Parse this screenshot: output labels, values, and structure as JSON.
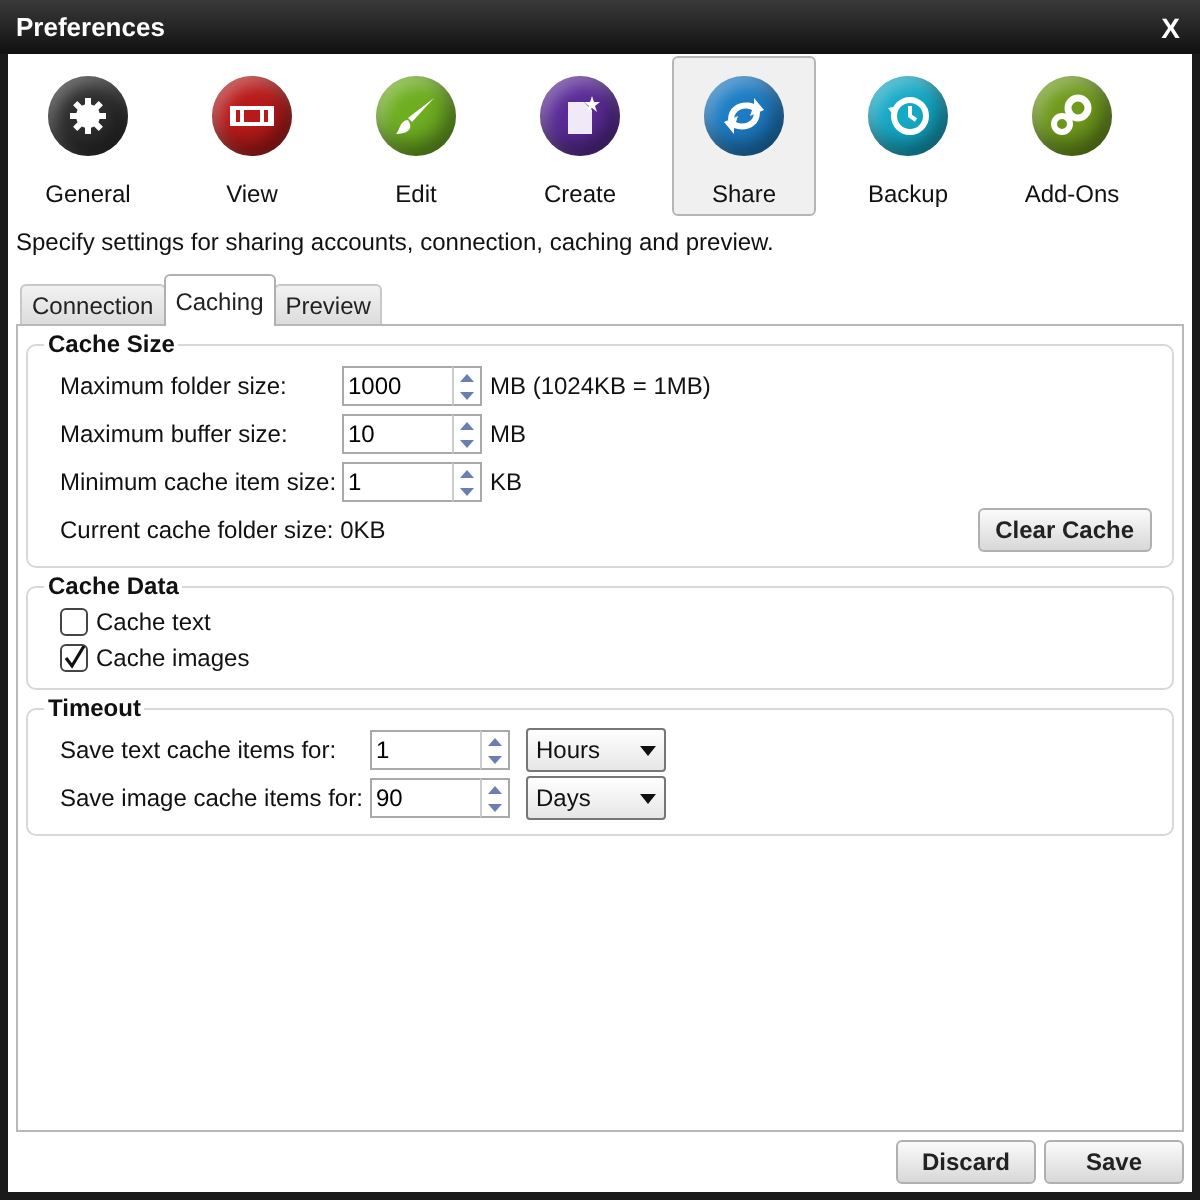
{
  "window": {
    "title": "Preferences",
    "close": "X"
  },
  "toolbar": [
    {
      "label": "General",
      "kind": "gear",
      "color": "#2e2e2e",
      "selected": false
    },
    {
      "label": "View",
      "kind": "film",
      "color": "#b81a1a",
      "selected": false
    },
    {
      "label": "Edit",
      "kind": "brush",
      "color": "#6fae22",
      "selected": false
    },
    {
      "label": "Create",
      "kind": "document",
      "color": "#5a2b96",
      "selected": false
    },
    {
      "label": "Share",
      "kind": "arrows",
      "color": "#1d7cc4",
      "selected": true
    },
    {
      "label": "Backup",
      "kind": "clock",
      "color": "#14a9c6",
      "selected": false
    },
    {
      "label": "Add-Ons",
      "kind": "gears",
      "color": "#6f9a1c",
      "selected": false
    }
  ],
  "description": "Specify settings for sharing accounts, connection, caching and preview.",
  "tabs": [
    {
      "label": "Connection",
      "selected": false
    },
    {
      "label": "Caching",
      "selected": true
    },
    {
      "label": "Preview",
      "selected": false
    }
  ],
  "cache_size": {
    "title": "Cache Size",
    "fields": [
      {
        "label": "Maximum folder size:",
        "value": "1000",
        "unit": "MB (1024KB = 1MB)"
      },
      {
        "label": "Maximum buffer size:",
        "value": "10",
        "unit": "MB"
      },
      {
        "label": "Minimum cache item size:",
        "value": "1",
        "unit": "KB"
      }
    ],
    "current_label": "Current cache folder size:",
    "current_value": "0KB",
    "button": "Clear Cache"
  },
  "cache_data": {
    "title": "Cache Data",
    "options": [
      {
        "label": "Cache text",
        "checked": false
      },
      {
        "label": "Cache images",
        "checked": true
      }
    ]
  },
  "timeout": {
    "title": "Timeout",
    "fields": [
      {
        "label": "Save text cache items for:",
        "value": "1",
        "unit": "Hours"
      },
      {
        "label": "Save image cache items for:",
        "value": "90",
        "unit": "Days"
      }
    ]
  },
  "buttons": [
    "Discard",
    "Save"
  ]
}
